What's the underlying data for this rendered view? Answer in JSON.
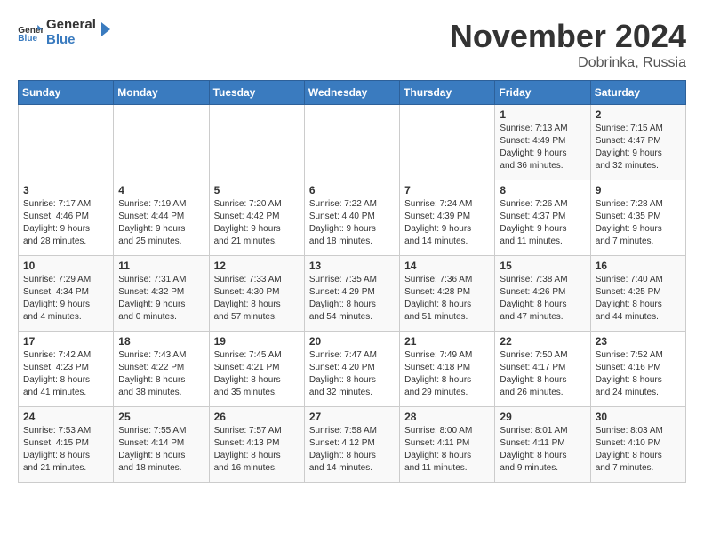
{
  "header": {
    "logo_general": "General",
    "logo_blue": "Blue",
    "month_title": "November 2024",
    "location": "Dobrinka, Russia"
  },
  "days_of_week": [
    "Sunday",
    "Monday",
    "Tuesday",
    "Wednesday",
    "Thursday",
    "Friday",
    "Saturday"
  ],
  "weeks": [
    [
      {
        "day": "",
        "info": ""
      },
      {
        "day": "",
        "info": ""
      },
      {
        "day": "",
        "info": ""
      },
      {
        "day": "",
        "info": ""
      },
      {
        "day": "",
        "info": ""
      },
      {
        "day": "1",
        "info": "Sunrise: 7:13 AM\nSunset: 4:49 PM\nDaylight: 9 hours\nand 36 minutes."
      },
      {
        "day": "2",
        "info": "Sunrise: 7:15 AM\nSunset: 4:47 PM\nDaylight: 9 hours\nand 32 minutes."
      }
    ],
    [
      {
        "day": "3",
        "info": "Sunrise: 7:17 AM\nSunset: 4:46 PM\nDaylight: 9 hours\nand 28 minutes."
      },
      {
        "day": "4",
        "info": "Sunrise: 7:19 AM\nSunset: 4:44 PM\nDaylight: 9 hours\nand 25 minutes."
      },
      {
        "day": "5",
        "info": "Sunrise: 7:20 AM\nSunset: 4:42 PM\nDaylight: 9 hours\nand 21 minutes."
      },
      {
        "day": "6",
        "info": "Sunrise: 7:22 AM\nSunset: 4:40 PM\nDaylight: 9 hours\nand 18 minutes."
      },
      {
        "day": "7",
        "info": "Sunrise: 7:24 AM\nSunset: 4:39 PM\nDaylight: 9 hours\nand 14 minutes."
      },
      {
        "day": "8",
        "info": "Sunrise: 7:26 AM\nSunset: 4:37 PM\nDaylight: 9 hours\nand 11 minutes."
      },
      {
        "day": "9",
        "info": "Sunrise: 7:28 AM\nSunset: 4:35 PM\nDaylight: 9 hours\nand 7 minutes."
      }
    ],
    [
      {
        "day": "10",
        "info": "Sunrise: 7:29 AM\nSunset: 4:34 PM\nDaylight: 9 hours\nand 4 minutes."
      },
      {
        "day": "11",
        "info": "Sunrise: 7:31 AM\nSunset: 4:32 PM\nDaylight: 9 hours\nand 0 minutes."
      },
      {
        "day": "12",
        "info": "Sunrise: 7:33 AM\nSunset: 4:30 PM\nDaylight: 8 hours\nand 57 minutes."
      },
      {
        "day": "13",
        "info": "Sunrise: 7:35 AM\nSunset: 4:29 PM\nDaylight: 8 hours\nand 54 minutes."
      },
      {
        "day": "14",
        "info": "Sunrise: 7:36 AM\nSunset: 4:28 PM\nDaylight: 8 hours\nand 51 minutes."
      },
      {
        "day": "15",
        "info": "Sunrise: 7:38 AM\nSunset: 4:26 PM\nDaylight: 8 hours\nand 47 minutes."
      },
      {
        "day": "16",
        "info": "Sunrise: 7:40 AM\nSunset: 4:25 PM\nDaylight: 8 hours\nand 44 minutes."
      }
    ],
    [
      {
        "day": "17",
        "info": "Sunrise: 7:42 AM\nSunset: 4:23 PM\nDaylight: 8 hours\nand 41 minutes."
      },
      {
        "day": "18",
        "info": "Sunrise: 7:43 AM\nSunset: 4:22 PM\nDaylight: 8 hours\nand 38 minutes."
      },
      {
        "day": "19",
        "info": "Sunrise: 7:45 AM\nSunset: 4:21 PM\nDaylight: 8 hours\nand 35 minutes."
      },
      {
        "day": "20",
        "info": "Sunrise: 7:47 AM\nSunset: 4:20 PM\nDaylight: 8 hours\nand 32 minutes."
      },
      {
        "day": "21",
        "info": "Sunrise: 7:49 AM\nSunset: 4:18 PM\nDaylight: 8 hours\nand 29 minutes."
      },
      {
        "day": "22",
        "info": "Sunrise: 7:50 AM\nSunset: 4:17 PM\nDaylight: 8 hours\nand 26 minutes."
      },
      {
        "day": "23",
        "info": "Sunrise: 7:52 AM\nSunset: 4:16 PM\nDaylight: 8 hours\nand 24 minutes."
      }
    ],
    [
      {
        "day": "24",
        "info": "Sunrise: 7:53 AM\nSunset: 4:15 PM\nDaylight: 8 hours\nand 21 minutes."
      },
      {
        "day": "25",
        "info": "Sunrise: 7:55 AM\nSunset: 4:14 PM\nDaylight: 8 hours\nand 18 minutes."
      },
      {
        "day": "26",
        "info": "Sunrise: 7:57 AM\nSunset: 4:13 PM\nDaylight: 8 hours\nand 16 minutes."
      },
      {
        "day": "27",
        "info": "Sunrise: 7:58 AM\nSunset: 4:12 PM\nDaylight: 8 hours\nand 14 minutes."
      },
      {
        "day": "28",
        "info": "Sunrise: 8:00 AM\nSunset: 4:11 PM\nDaylight: 8 hours\nand 11 minutes."
      },
      {
        "day": "29",
        "info": "Sunrise: 8:01 AM\nSunset: 4:11 PM\nDaylight: 8 hours\nand 9 minutes."
      },
      {
        "day": "30",
        "info": "Sunrise: 8:03 AM\nSunset: 4:10 PM\nDaylight: 8 hours\nand 7 minutes."
      }
    ]
  ]
}
